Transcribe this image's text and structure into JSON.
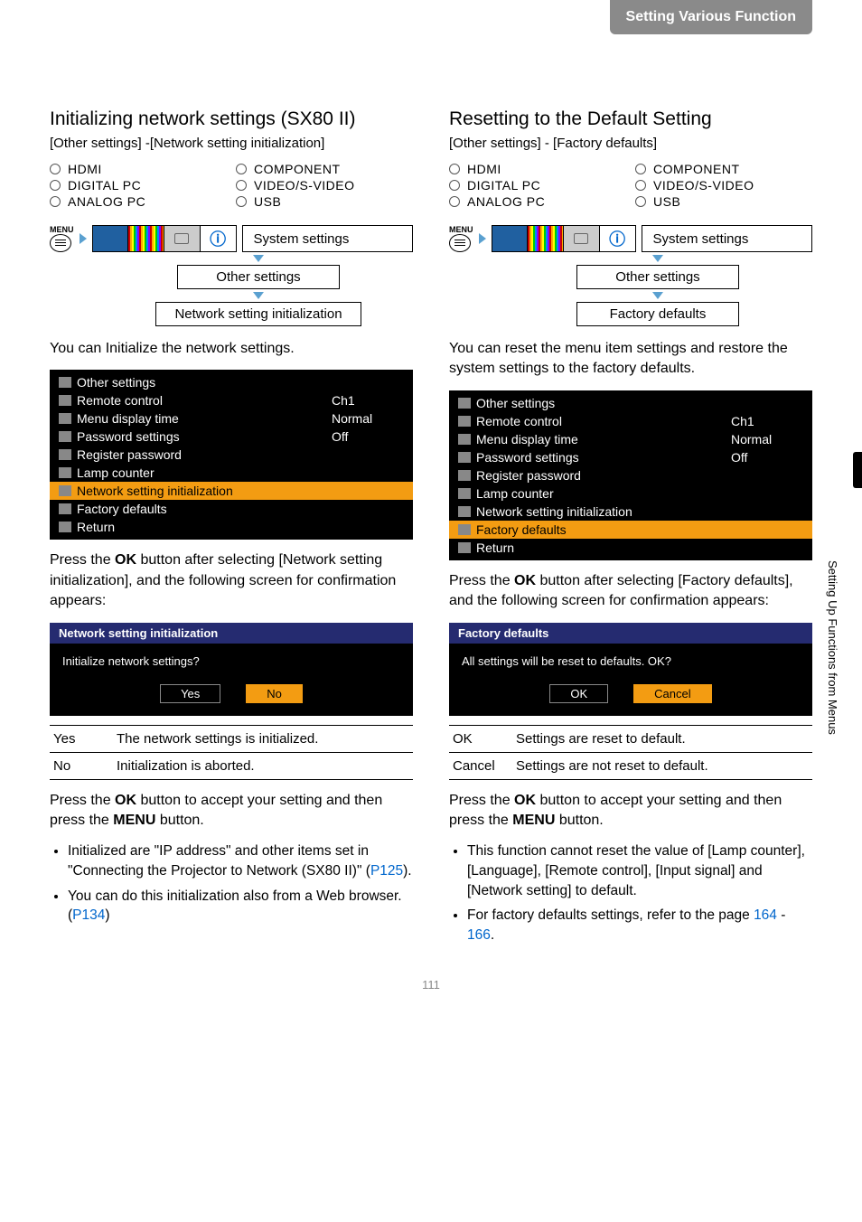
{
  "header": "Setting Various Function",
  "side_label": "Setting Up Functions from Menus",
  "page_number": "111",
  "inputs": [
    "HDMI",
    "COMPONENT",
    "DIGITAL PC",
    "VIDEO/S-VIDEO",
    "ANALOG PC",
    "USB"
  ],
  "menu_small": "MENU",
  "left": {
    "title": "Initializing network settings (SX80 II)",
    "path": "[Other settings] -[Network setting initialization]",
    "sys": "System settings",
    "chain1": "Other settings",
    "chain2": "Network setting initialization",
    "intro": "You can Initialize the network settings.",
    "osd": {
      "header": "Other settings",
      "rows": [
        {
          "label": "Remote control",
          "val": "Ch1"
        },
        {
          "label": "Menu display time",
          "val": "Normal"
        },
        {
          "label": "Password settings",
          "val": "Off"
        },
        {
          "label": "Register password",
          "val": ""
        },
        {
          "label": "Lamp counter",
          "val": ""
        },
        {
          "label": "Network setting initialization",
          "val": "",
          "hl": true
        },
        {
          "label": "Factory defaults",
          "val": ""
        },
        {
          "label": "Return",
          "val": ""
        }
      ]
    },
    "after_osd": "Press the OK button after selecting [Network setting initialization], and the following screen for confirmation appears:",
    "confirm": {
      "title": "Network setting initialization",
      "msg": "Initialize network settings?",
      "yes": "Yes",
      "no": "No"
    },
    "table": [
      {
        "k": "Yes",
        "v": "The network settings is initialized."
      },
      {
        "k": "No",
        "v": "Initialization is aborted."
      }
    ],
    "accept": "Press the OK button to accept your setting and then press the MENU button.",
    "bullets": [
      {
        "pre": "Initialized are \"IP address\" and other items set in \"Connecting the Projector to Network (SX80 II)\" (",
        "link": "P125",
        "post": ")."
      },
      {
        "pre": "You can do this initialization also from a Web browser. (",
        "link": "P134",
        "post": ")"
      }
    ]
  },
  "right": {
    "title": "Resetting to the Default Setting",
    "path": "[Other settings] - [Factory defaults]",
    "sys": "System settings",
    "chain1": "Other settings",
    "chain2": "Factory defaults",
    "intro": "You can reset the menu item settings and restore the system settings to the factory defaults.",
    "osd": {
      "header": "Other settings",
      "rows": [
        {
          "label": "Remote control",
          "val": "Ch1"
        },
        {
          "label": "Menu display time",
          "val": "Normal"
        },
        {
          "label": "Password settings",
          "val": "Off"
        },
        {
          "label": "Register password",
          "val": ""
        },
        {
          "label": "Lamp counter",
          "val": ""
        },
        {
          "label": "Network setting initialization",
          "val": ""
        },
        {
          "label": "Factory defaults",
          "val": "",
          "hl": true
        },
        {
          "label": "Return",
          "val": ""
        }
      ]
    },
    "after_osd": "Press the OK button after selecting [Factory defaults], and the following screen for confirmation appears:",
    "confirm": {
      "title": "Factory defaults",
      "msg": "All settings will be reset to defaults. OK?",
      "ok": "OK",
      "cancel": "Cancel"
    },
    "table": [
      {
        "k": "OK",
        "v": "Settings are reset to default."
      },
      {
        "k": "Cancel",
        "v": "Settings are not reset to default."
      }
    ],
    "accept": "Press the OK button to accept your setting and then press the MENU button.",
    "bullets": [
      {
        "pre": "This function cannot reset the value of [Lamp counter], [Language], [Remote control], [Input signal] and [Network setting] to default.",
        "link": "",
        "post": ""
      },
      {
        "pre": "For factory defaults settings, refer to the page ",
        "link": "164",
        "post2": " - ",
        "link2": "166",
        "post": "."
      }
    ]
  }
}
